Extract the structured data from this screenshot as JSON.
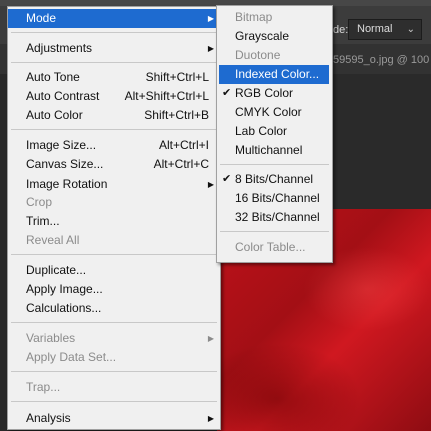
{
  "toolbar": {
    "blend_label": "de:",
    "blend_value": "Normal"
  },
  "document_tab": "59595_o.jpg @ 100",
  "menu": {
    "items": [
      {
        "label": "Mode",
        "has_submenu": true,
        "state": "highlight"
      },
      {
        "label": "Adjustments",
        "has_submenu": true
      },
      {
        "label": "Auto Tone",
        "shortcut": "Shift+Ctrl+L"
      },
      {
        "label": "Auto Contrast",
        "shortcut": "Alt+Shift+Ctrl+L"
      },
      {
        "label": "Auto Color",
        "shortcut": "Shift+Ctrl+B"
      },
      {
        "label": "Image Size...",
        "shortcut": "Alt+Ctrl+I"
      },
      {
        "label": "Canvas Size...",
        "shortcut": "Alt+Ctrl+C"
      },
      {
        "label": "Image Rotation",
        "has_submenu": true
      },
      {
        "label": "Crop",
        "state": "disabled"
      },
      {
        "label": "Trim..."
      },
      {
        "label": "Reveal All",
        "state": "disabled"
      },
      {
        "label": "Duplicate..."
      },
      {
        "label": "Apply Image..."
      },
      {
        "label": "Calculations..."
      },
      {
        "label": "Variables",
        "has_submenu": true,
        "state": "disabled"
      },
      {
        "label": "Apply Data Set...",
        "state": "disabled"
      },
      {
        "label": "Trap...",
        "state": "disabled"
      },
      {
        "label": "Analysis",
        "has_submenu": true
      }
    ]
  },
  "submenu": {
    "items": [
      {
        "label": "Bitmap",
        "state": "disabled"
      },
      {
        "label": "Grayscale"
      },
      {
        "label": "Duotone",
        "state": "disabled"
      },
      {
        "label": "Indexed Color...",
        "state": "highlight"
      },
      {
        "label": "RGB Color",
        "checked": true
      },
      {
        "label": "CMYK Color"
      },
      {
        "label": "Lab Color"
      },
      {
        "label": "Multichannel"
      },
      {
        "label": "8 Bits/Channel",
        "checked": true
      },
      {
        "label": "16 Bits/Channel"
      },
      {
        "label": "32 Bits/Channel"
      },
      {
        "label": "Color Table...",
        "state": "disabled"
      }
    ]
  },
  "glyphs": {
    "submenu_arrow": "▶",
    "check": "✔",
    "dropdown": "⌄"
  },
  "colors": {
    "highlight": "#1e6bd0",
    "menu_bg": "#f0f0f0",
    "disabled_text": "#8b8b8b"
  }
}
